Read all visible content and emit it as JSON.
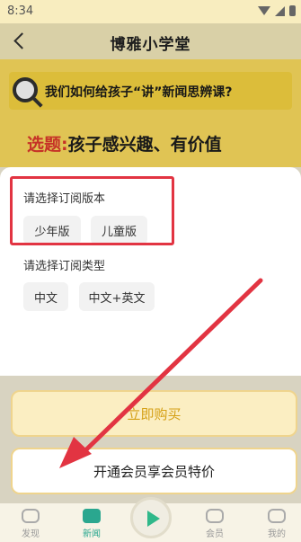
{
  "status_bar": {
    "time": "8:34"
  },
  "header": {
    "title": "博雅小学堂"
  },
  "banner": {
    "question": "我们如何给孩子“讲”新闻思辨课?",
    "topic_prefix": "选题:",
    "topic_text": "孩子感兴趣、有价值"
  },
  "sheet": {
    "version_label": "请选择订阅版本",
    "versions": [
      "少年版",
      "儿童版"
    ],
    "type_label": "请选择订阅类型",
    "types": [
      "中文",
      "中文+英文"
    ]
  },
  "buttons": {
    "buy": "立即购买",
    "member": "开通会员享会员特价"
  },
  "tabbar": {
    "items": [
      {
        "label": "发现",
        "icon": "eye-icon"
      },
      {
        "label": "新闻",
        "icon": "news-icon"
      },
      {
        "label": "会员",
        "icon": "member-icon"
      },
      {
        "label": "我的",
        "icon": "profile-icon"
      }
    ]
  },
  "colors": {
    "accent_gold": "#d5a016",
    "highlight_red": "#e23442",
    "active_tab": "#2aa78f"
  }
}
